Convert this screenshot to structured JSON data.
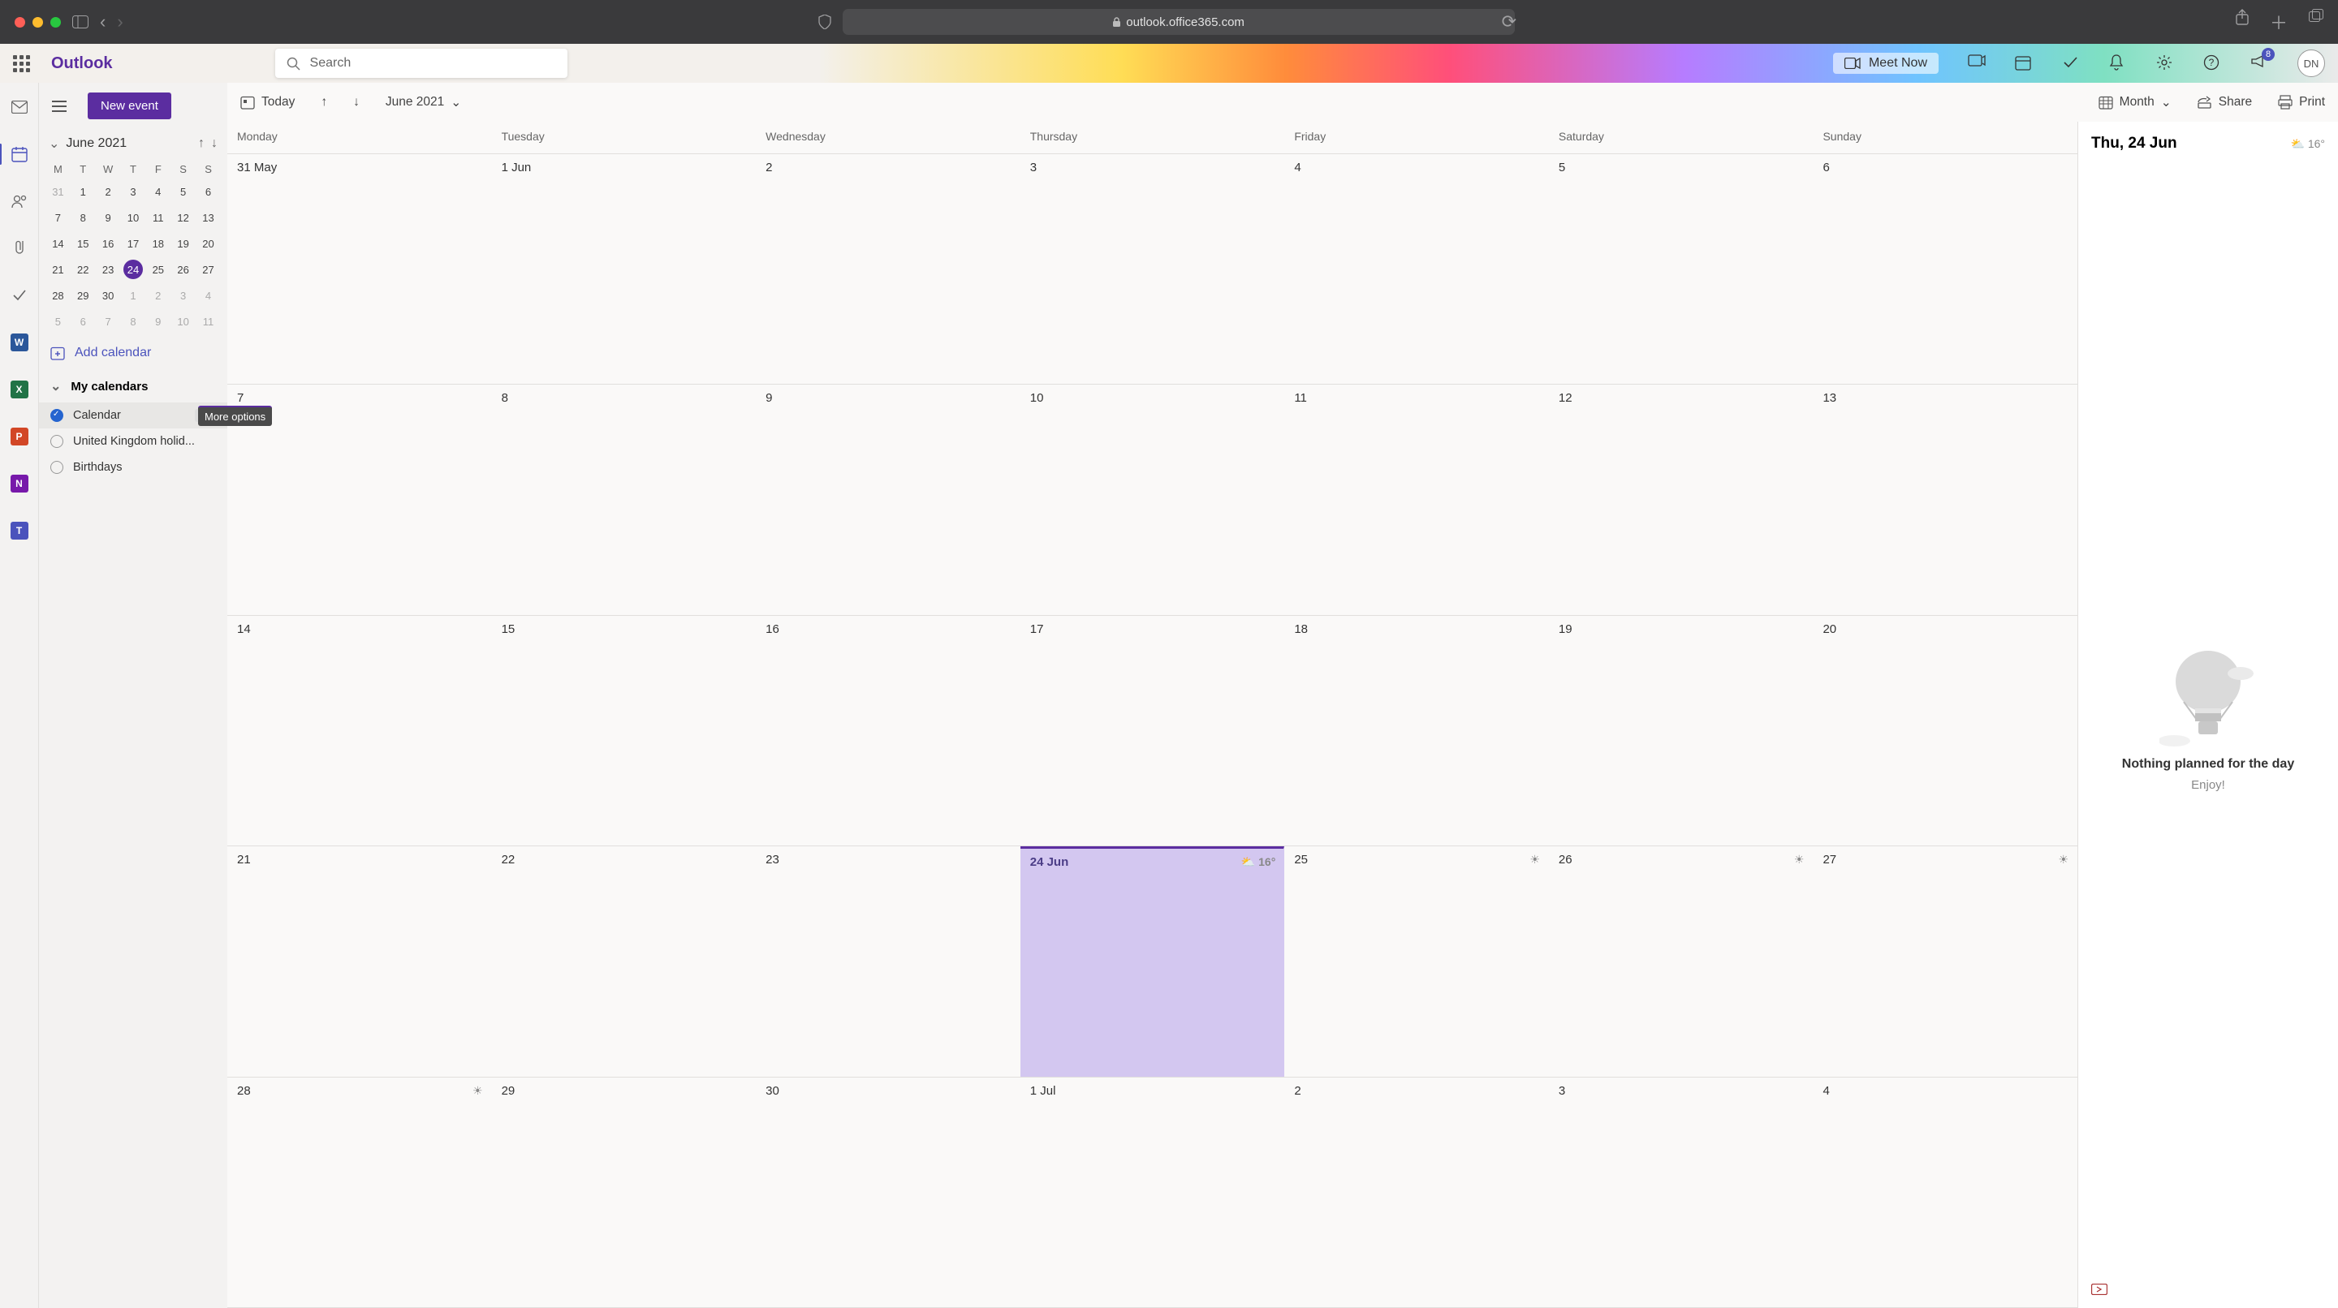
{
  "browser": {
    "url": "outlook.office365.com"
  },
  "header": {
    "brand": "Outlook",
    "search_placeholder": "Search",
    "meet_now": "Meet Now",
    "badge": "8",
    "avatar": "DN"
  },
  "sidebar": {
    "new_event": "New event",
    "month_label": "June 2021",
    "dow": [
      "M",
      "T",
      "W",
      "T",
      "F",
      "S",
      "S"
    ],
    "mini_rows": [
      [
        {
          "d": "31",
          "out": true
        },
        {
          "d": "1"
        },
        {
          "d": "2"
        },
        {
          "d": "3"
        },
        {
          "d": "4"
        },
        {
          "d": "5"
        },
        {
          "d": "6"
        }
      ],
      [
        {
          "d": "7"
        },
        {
          "d": "8"
        },
        {
          "d": "9"
        },
        {
          "d": "10"
        },
        {
          "d": "11"
        },
        {
          "d": "12"
        },
        {
          "d": "13"
        }
      ],
      [
        {
          "d": "14"
        },
        {
          "d": "15"
        },
        {
          "d": "16"
        },
        {
          "d": "17"
        },
        {
          "d": "18"
        },
        {
          "d": "19"
        },
        {
          "d": "20"
        }
      ],
      [
        {
          "d": "21"
        },
        {
          "d": "22"
        },
        {
          "d": "23"
        },
        {
          "d": "24",
          "sel": true
        },
        {
          "d": "25"
        },
        {
          "d": "26"
        },
        {
          "d": "27"
        }
      ],
      [
        {
          "d": "28"
        },
        {
          "d": "29"
        },
        {
          "d": "30"
        },
        {
          "d": "1",
          "out": true
        },
        {
          "d": "2",
          "out": true
        },
        {
          "d": "3",
          "out": true
        },
        {
          "d": "4",
          "out": true
        }
      ],
      [
        {
          "d": "5",
          "out": true
        },
        {
          "d": "6",
          "out": true
        },
        {
          "d": "7",
          "out": true
        },
        {
          "d": "8",
          "out": true
        },
        {
          "d": "9",
          "out": true
        },
        {
          "d": "10",
          "out": true
        },
        {
          "d": "11",
          "out": true
        }
      ]
    ],
    "add_calendar": "Add calendar",
    "my_calendars": "My calendars",
    "calendars": [
      {
        "name": "Calendar",
        "checked": true,
        "hover": true
      },
      {
        "name": "United Kingdom holid...",
        "checked": false
      },
      {
        "name": "Birthdays",
        "checked": false
      }
    ],
    "tooltip": "More options"
  },
  "toolbar": {
    "today": "Today",
    "month_label": "June 2021",
    "view": "Month",
    "share": "Share",
    "print": "Print"
  },
  "grid": {
    "dow": [
      "Monday",
      "Tuesday",
      "Wednesday",
      "Thursday",
      "Friday",
      "Saturday",
      "Sunday"
    ],
    "weeks": [
      [
        {
          "d": "31 May"
        },
        {
          "d": "1 Jun"
        },
        {
          "d": "2"
        },
        {
          "d": "3"
        },
        {
          "d": "4"
        },
        {
          "d": "5"
        },
        {
          "d": "6"
        }
      ],
      [
        {
          "d": "7"
        },
        {
          "d": "8"
        },
        {
          "d": "9"
        },
        {
          "d": "10"
        },
        {
          "d": "11"
        },
        {
          "d": "12"
        },
        {
          "d": "13"
        }
      ],
      [
        {
          "d": "14"
        },
        {
          "d": "15"
        },
        {
          "d": "16"
        },
        {
          "d": "17"
        },
        {
          "d": "18"
        },
        {
          "d": "19"
        },
        {
          "d": "20"
        }
      ],
      [
        {
          "d": "21"
        },
        {
          "d": "22"
        },
        {
          "d": "23"
        },
        {
          "d": "24 Jun",
          "today": true,
          "weather": "⛅ 16°"
        },
        {
          "d": "25",
          "weather": "☀"
        },
        {
          "d": "26",
          "weather": "☀"
        },
        {
          "d": "27",
          "weather": "☀"
        }
      ],
      [
        {
          "d": "28",
          "weather": "☀"
        },
        {
          "d": "29"
        },
        {
          "d": "30"
        },
        {
          "d": "1 Jul"
        },
        {
          "d": "2"
        },
        {
          "d": "3"
        },
        {
          "d": "4"
        }
      ]
    ]
  },
  "rpane": {
    "title": "Thu, 24 Jun",
    "temp": "⛅ 16°",
    "line1": "Nothing planned for the day",
    "line2": "Enjoy!"
  }
}
